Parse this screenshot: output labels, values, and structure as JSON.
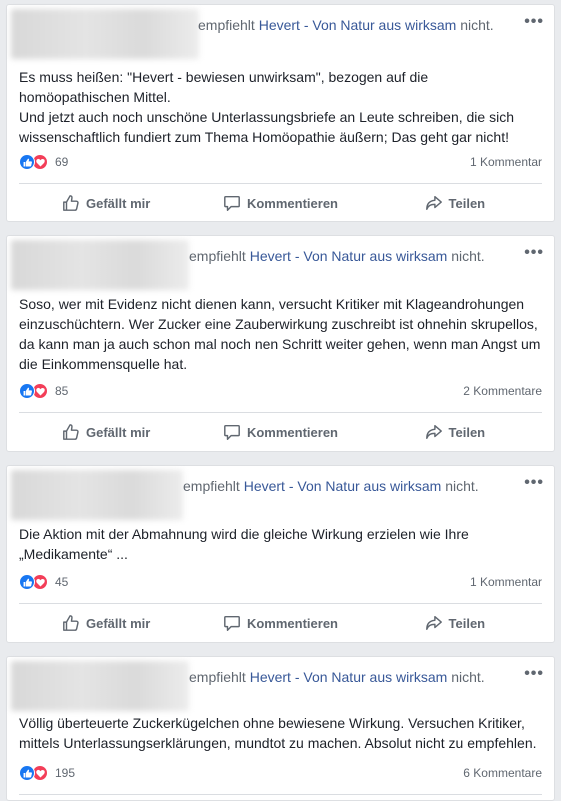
{
  "recommend": {
    "prefix": "empfiehlt",
    "page": "Hevert - Von Natur aus wirksam",
    "suffix": "nicht."
  },
  "labels": {
    "like": "Gefällt mir",
    "comment": "Kommentieren",
    "share": "Teilen",
    "more": "•••"
  },
  "icons": {
    "like": "thumbs-up-icon",
    "comment": "comment-icon",
    "share": "share-icon",
    "like_reaction": "like-reaction-icon",
    "love_reaction": "love-reaction-icon"
  },
  "colors": {
    "like": "#1877f2",
    "love": "#f33e58",
    "link": "#385898"
  },
  "posts": [
    {
      "lines": [
        "Es muss heißen: \"Hevert - bewiesen unwirksam\", bezogen auf die homöopathischen Mittel.",
        "Und jetzt auch noch unschöne Unterlassungsbriefe an Leute schreiben, die sich wissenschaftlich fundiert zum Thema Homöopathie äußern; Das geht gar nicht!"
      ],
      "reactions": "69",
      "comments": "1 Kommentar"
    },
    {
      "lines": [
        "Soso, wer mit Evidenz nicht dienen kann, versucht Kritiker mit Klageandrohungen einzuschüchtern. Wer Zucker eine Zauberwirkung zuschreibt ist ohnehin skrupellos, da kann man ja auch schon mal noch nen Schritt weiter gehen, wenn man Angst um die Einkommensquelle hat."
      ],
      "reactions": "85",
      "comments": "2 Kommentare"
    },
    {
      "lines": [
        "Die Aktion mit der Abmahnung wird die gleiche Wirkung erzielen wie Ihre „Medikamente“ ..."
      ],
      "reactions": "45",
      "comments": "1 Kommentar"
    },
    {
      "lines": [
        "Völlig überteuerte Zuckerkügelchen ohne bewiesene Wirkung. Versuchen Kritiker, mittels Unterlassungserklärungen, mundtot zu machen. Absolut nicht zu empfehlen."
      ],
      "reactions": "195",
      "comments": "6 Kommentare"
    }
  ]
}
